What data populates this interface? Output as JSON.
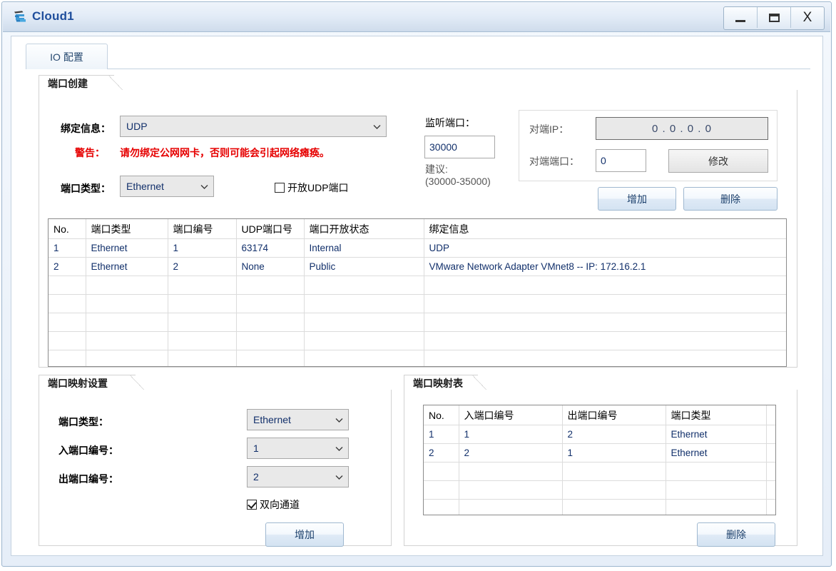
{
  "window": {
    "title": "Cloud1",
    "icon": "cloud-device-icon",
    "buttons": {
      "minimize": "minimize-icon",
      "maximize": "maximize-icon",
      "close": "X"
    }
  },
  "tabs": [
    {
      "label": "IO 配置",
      "active": true
    }
  ],
  "port_create": {
    "legend": "端口创建",
    "bind_info_label": "绑定信息：",
    "bind_info_value": "UDP",
    "warning_label": "警告：",
    "warning_text": "请勿绑定公网网卡，否则可能会引起网络瘫痪。",
    "port_type_label": "端口类型：",
    "port_type_value": "Ethernet",
    "open_udp_label": "开放UDP端口",
    "open_udp_checked": false,
    "listen_port_label": "监听端口：",
    "listen_port_value": "30000",
    "suggest_label": "建议:",
    "suggest_range": "(30000-35000)",
    "peer_ip_label": "对端IP：",
    "peer_ip_value": "0  .  0  .  0  .  0",
    "peer_port_label": "对端端口：",
    "peer_port_value": "0",
    "modify_button": "修改",
    "add_button": "增加",
    "delete_button": "删除"
  },
  "port_table": {
    "columns": [
      "No.",
      "端口类型",
      "端口编号",
      "UDP端口号",
      "端口开放状态",
      "绑定信息"
    ],
    "rows": [
      [
        "1",
        "Ethernet",
        "1",
        "63174",
        "Internal",
        "UDP"
      ],
      [
        "2",
        "Ethernet",
        "2",
        "None",
        "Public",
        "VMware Network Adapter VMnet8 -- IP: 172.16.2.1"
      ]
    ],
    "empty_rows": 5
  },
  "mapping_settings": {
    "legend": "端口映射设置",
    "port_type_label": "端口类型：",
    "port_type_value": "Ethernet",
    "in_port_label": "入端口编号：",
    "in_port_value": "1",
    "out_port_label": "出端口编号：",
    "out_port_value": "2",
    "bidirectional_label": "双向通道",
    "bidirectional_checked": true,
    "add_button": "增加"
  },
  "mapping_table": {
    "legend": "端口映射表",
    "columns": [
      "No.",
      "入端口编号",
      "出端口编号",
      "端口类型"
    ],
    "rows": [
      [
        "1",
        "1",
        "2",
        "Ethernet"
      ],
      [
        "2",
        "2",
        "1",
        "Ethernet"
      ]
    ],
    "empty_rows": 3,
    "delete_button": "删除"
  },
  "colors": {
    "title_text": "#1f4e9c",
    "warning": "#e60000",
    "value_text": "#12306b",
    "frame": "#9cb5cd"
  }
}
